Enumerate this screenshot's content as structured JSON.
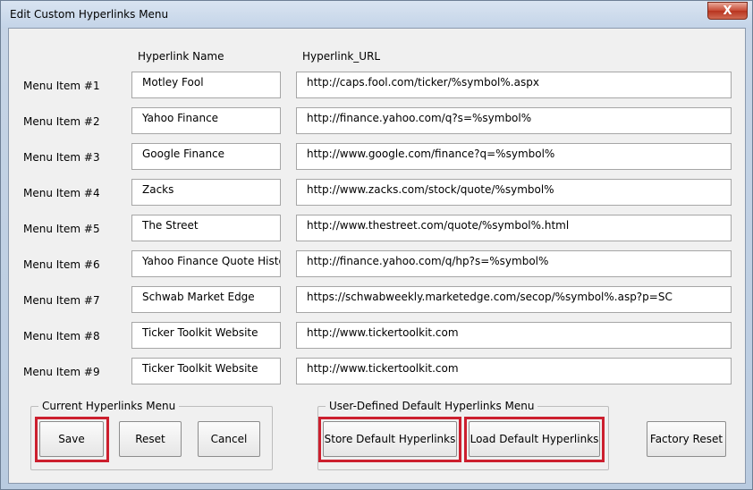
{
  "window": {
    "title": "Edit Custom Hyperlinks Menu",
    "close_glyph": "X"
  },
  "headers": {
    "name": "Hyperlink Name",
    "url": "Hyperlink_URL"
  },
  "rows": [
    {
      "label": "Menu Item #1",
      "name": "Motley Fool",
      "url": "http://caps.fool.com/ticker/%symbol%.aspx"
    },
    {
      "label": "Menu Item #2",
      "name": "Yahoo Finance",
      "url": "http://finance.yahoo.com/q?s=%symbol%"
    },
    {
      "label": "Menu Item #3",
      "name": "Google Finance",
      "url": "http://www.google.com/finance?q=%symbol%"
    },
    {
      "label": "Menu Item #4",
      "name": "Zacks",
      "url": "http://www.zacks.com/stock/quote/%symbol%"
    },
    {
      "label": "Menu Item #5",
      "name": "The Street",
      "url": "http://www.thestreet.com/quote/%symbol%.html"
    },
    {
      "label": "Menu Item #6",
      "name": "Yahoo Finance Quote History",
      "url": "http://finance.yahoo.com/q/hp?s=%symbol%"
    },
    {
      "label": "Menu Item #7",
      "name": "Schwab Market Edge",
      "url": "https://schwabweekly.marketedge.com/secop/%symbol%.asp?p=SC"
    },
    {
      "label": "Menu Item #8",
      "name": "Ticker Toolkit Website",
      "url": "http://www.tickertoolkit.com"
    },
    {
      "label": "Menu Item #9",
      "name": "Ticker Toolkit Website",
      "url": "http://www.tickertoolkit.com"
    }
  ],
  "current_group": {
    "legend": "Current Hyperlinks Menu",
    "save": "Save",
    "reset": "Reset",
    "cancel": "Cancel"
  },
  "default_group": {
    "legend": "User-Defined Default Hyperlinks Menu",
    "store": "Store Default Hyperlinks",
    "load": "Load Default Hyperlinks"
  },
  "factory_reset": "Factory Reset",
  "colors": {
    "highlight": "#cc1f2e",
    "close_button": "#c74a34"
  }
}
